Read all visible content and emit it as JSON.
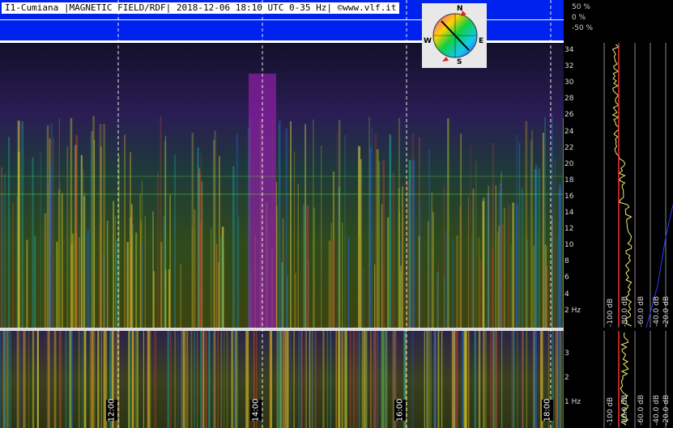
{
  "header": {
    "title": "I1-Cumiana |MAGNETIC FIELD/RDF| 2018-12-06 18:10 UTC 0-35 Hz| ©www.vlf.it"
  },
  "direction_scale": [
    "50 %",
    "0 %",
    "-50 %"
  ],
  "compass": {
    "n": "N",
    "e": "E",
    "s": "S",
    "w": "W"
  },
  "frequency_axis_main": [
    "34",
    "32",
    "30",
    "28",
    "26",
    "24",
    "22",
    "20",
    "18",
    "16",
    "14",
    "12",
    "10",
    "8",
    "6",
    "4",
    "2 Hz"
  ],
  "frequency_axis_lower": [
    "3",
    "2",
    "1 Hz"
  ],
  "time_labels": [
    "12:00",
    "14:00",
    "16:00",
    "18:00"
  ],
  "db_scale_main": [
    "-100 dB",
    "-80.0 dB",
    "-60.0 dB",
    "-40.0 dB",
    "-20.0 dB"
  ],
  "db_scale_lower": [
    "-100 dB",
    "-80.0 dB",
    "-60.0 dB",
    "-40.0 dB",
    "-20.0 dB"
  ],
  "colors": {
    "header_bg": "#0022ee",
    "background": "#000000",
    "spectrum_line": "#f4f070",
    "mean_line": "#ff3030",
    "grid_dash": "#ffffff"
  }
}
